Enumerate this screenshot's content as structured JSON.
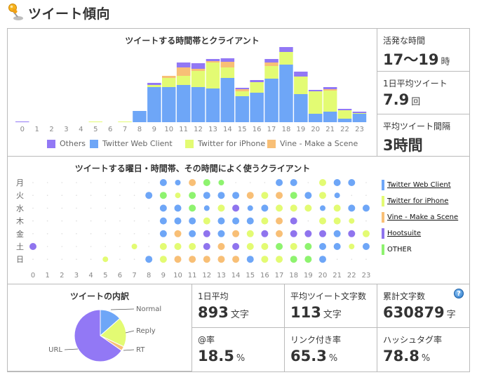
{
  "header": {
    "title": "ツイート傾向",
    "icon": "pushpin-icon"
  },
  "colors": {
    "others": "#9278f5",
    "web": "#6ea6f7",
    "iphone": "#e3fb73",
    "vine": "#f8bf76",
    "hootsuite": "#8f74ee",
    "other": "#8ef36f"
  },
  "hourly_chart": {
    "title": "ツイートする時間帯とクライアント",
    "legend": [
      {
        "key": "others",
        "label": "Others"
      },
      {
        "key": "web",
        "label": "Twitter Web Client"
      },
      {
        "key": "iphone",
        "label": "Twitter for iPhone"
      },
      {
        "key": "vine",
        "label": "Vine - Make a Scene"
      }
    ]
  },
  "chart_data": [
    {
      "type": "bar",
      "stacked": true,
      "title": "ツイートする時間帯とクライアント",
      "xlabel": "",
      "ylabel": "",
      "categories": [
        "0",
        "1",
        "2",
        "3",
        "4",
        "5",
        "6",
        "7",
        "8",
        "9",
        "10",
        "11",
        "12",
        "13",
        "14",
        "15",
        "16",
        "17",
        "18",
        "19",
        "20",
        "21",
        "22",
        "23"
      ],
      "ylim": [
        0,
        110
      ],
      "series": [
        {
          "name": "Twitter Web Client",
          "key": "web",
          "values": [
            0,
            0,
            0,
            0,
            0,
            0,
            0,
            0,
            16,
            50,
            50,
            53,
            50,
            48,
            63,
            37,
            42,
            62,
            82,
            40,
            12,
            15,
            5,
            12
          ]
        },
        {
          "name": "Twitter for iPhone",
          "key": "iphone",
          "values": [
            0,
            0,
            0,
            0,
            0,
            1,
            0,
            1,
            0,
            3,
            13,
            13,
            23,
            37,
            15,
            7,
            15,
            18,
            18,
            25,
            32,
            30,
            12,
            1
          ]
        },
        {
          "name": "Vine - Make a Scene",
          "key": "vine",
          "values": [
            0,
            0,
            0,
            0,
            0,
            0,
            0,
            0,
            0,
            0,
            3,
            12,
            3,
            2,
            8,
            3,
            0,
            5,
            0,
            0,
            0,
            2,
            0,
            0
          ]
        },
        {
          "name": "Others",
          "key": "others",
          "values": [
            1,
            0,
            0,
            0,
            0,
            0,
            0,
            0,
            0,
            3,
            0,
            7,
            8,
            3,
            5,
            2,
            3,
            5,
            7,
            7,
            2,
            3,
            2,
            2
          ]
        }
      ],
      "legend_position": "bottom"
    },
    {
      "type": "scatter",
      "title": "ツイートする曜日・時間帯、その時間によく使うクライアント",
      "x_ticks": [
        "0",
        "1",
        "2",
        "3",
        "4",
        "5",
        "6",
        "7",
        "8",
        "9",
        "10",
        "11",
        "12",
        "13",
        "14",
        "15",
        "16",
        "17",
        "18",
        "19",
        "20",
        "21",
        "22",
        "23"
      ],
      "y_ticks": [
        "月",
        "火",
        "水",
        "木",
        "金",
        "土",
        "日"
      ],
      "size_note": "L=large dot, S=small dot, -=none",
      "rows": [
        {
          "day": "月",
          "cells": [
            "-",
            "-",
            "-",
            "-",
            "-",
            "-",
            "-",
            "-",
            "-",
            "web:L",
            "web:S",
            "vine:L",
            "other:L",
            "other:S",
            "-",
            "-",
            "-",
            "web:L",
            "web:L",
            "-",
            "iphone:L",
            "web:L",
            "web:L",
            "-"
          ]
        },
        {
          "day": "火",
          "cells": [
            "-",
            "-",
            "-",
            "-",
            "-",
            "-",
            "-",
            "-",
            "web:L",
            "other:L",
            "iphone:S",
            "other:L",
            "web:L",
            "web:L",
            "web:L",
            "vine:L",
            "iphone:L",
            "vine:L",
            "other:L",
            "web:L",
            "iphone:L",
            "web:S",
            "-",
            "-"
          ]
        },
        {
          "day": "水",
          "cells": [
            "-",
            "-",
            "-",
            "-",
            "-",
            "-",
            "-",
            "-",
            "-",
            "web:L",
            "web:L",
            "other:L",
            "web:S",
            "iphone:L",
            "hootsuite:L",
            "web:S",
            "web:L",
            "iphone:L",
            "iphone:L",
            "iphone:L",
            "web:S",
            "iphone:L",
            "web:L",
            "web:L"
          ]
        },
        {
          "day": "木",
          "cells": [
            "-",
            "-",
            "-",
            "-",
            "-",
            "-",
            "-",
            "-",
            "-",
            "web:L",
            "web:L",
            "web:L",
            "iphone:L",
            "web:L",
            "web:L",
            "web:L",
            "iphone:L",
            "vine:L",
            "hootsuite:L",
            "-",
            "iphone:L",
            "iphone:L",
            "iphone:S",
            "-"
          ]
        },
        {
          "day": "金",
          "cells": [
            "-",
            "-",
            "-",
            "-",
            "-",
            "-",
            "-",
            "-",
            "-",
            "web:L",
            "vine:L",
            "web:L",
            "hootsuite:L",
            "web:L",
            "vine:L",
            "iphone:L",
            "hootsuite:L",
            "vine:L",
            "hootsuite:L",
            "hootsuite:L",
            "hootsuite:L",
            "web:L",
            "hootsuite:L",
            "iphone:L"
          ]
        },
        {
          "day": "土",
          "cells": [
            "hootsuite:L",
            "-",
            "-",
            "-",
            "-",
            "-",
            "-",
            "iphone:S",
            "-",
            "iphone:L",
            "iphone:L",
            "iphone:L",
            "hootsuite:L",
            "vine:L",
            "hootsuite:L",
            "iphone:L",
            "iphone:L",
            "other:L",
            "iphone:L",
            "other:L",
            "web:L",
            "web:L",
            "iphone:S",
            "web:L"
          ]
        },
        {
          "day": "日",
          "cells": [
            "-",
            "-",
            "-",
            "-",
            "-",
            "iphone:S",
            "-",
            "-",
            "web:L",
            "iphone:L",
            "vine:L",
            "vine:L",
            "vine:L",
            "vine:L",
            "vine:L",
            "web:L",
            "iphone:L",
            "iphone:L",
            "other:L",
            "other:L",
            "web:L",
            "-",
            "-",
            "-"
          ]
        }
      ]
    },
    {
      "type": "pie",
      "title": "ツイートの内訳",
      "labels": [
        "Normal",
        "Reply",
        "RT",
        "URL"
      ],
      "values": [
        13.5,
        18.5,
        2.7,
        65.3
      ],
      "keys": [
        "web",
        "iphone",
        "vine",
        "others"
      ]
    }
  ],
  "dot_chart": {
    "title": "ツイートする曜日・時間帯、その時間によく使うクライアント",
    "client_legend": [
      {
        "key": "web",
        "label": "Twitter Web Client",
        "link": true
      },
      {
        "key": "iphone",
        "label": "Twitter for iPhone",
        "link": true
      },
      {
        "key": "vine",
        "label": "Vine - Make a Scene",
        "link": true
      },
      {
        "key": "hootsuite",
        "label": "Hootsuite",
        "link": true
      },
      {
        "key": "other",
        "label": "OTHER",
        "link": false
      }
    ]
  },
  "side_stats": [
    {
      "label": "活発な時間",
      "value": "17〜19",
      "unit": "時"
    },
    {
      "label": "1日平均ツイート",
      "value": "7.9",
      "unit": "回"
    },
    {
      "label": "平均ツイート間隔",
      "value": "3時間",
      "unit": ""
    }
  ],
  "pie": {
    "title": "ツイートの内訳"
  },
  "bottom_stats": [
    {
      "label": "1日平均",
      "value": "893",
      "unit": "文字"
    },
    {
      "label": "平均ツイート文字数",
      "value": "113",
      "unit": "文字"
    },
    {
      "label": "累計文字数",
      "value": "630879",
      "unit": "字",
      "help": "?"
    },
    {
      "label": "@率",
      "value": "18.5",
      "unit": "%"
    },
    {
      "label": "リンク付き率",
      "value": "65.3",
      "unit": "%"
    },
    {
      "label": "ハッシュタグ率",
      "value": "78.8",
      "unit": "%"
    }
  ]
}
